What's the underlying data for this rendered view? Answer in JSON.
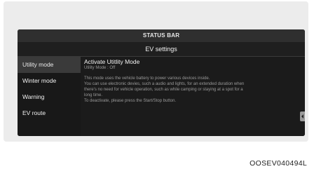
{
  "status_bar": {
    "label": "STATUS BAR"
  },
  "header": {
    "title": "EV settings"
  },
  "sidebar": {
    "items": [
      {
        "label": "Utility mode",
        "active": true
      },
      {
        "label": "Winter mode",
        "active": false
      },
      {
        "label": "Warning",
        "active": false
      },
      {
        "label": "EV route",
        "active": false
      }
    ]
  },
  "content": {
    "title": "Activate Utitlity Mode",
    "subtitle": "Utility Mode : Off",
    "body_lines": [
      "This mode uses the vehicle battery to power various devices inside.",
      "You can use electronic devies, such a audio and lights, for an extended duration when",
      "there's no need for vehicle operation, such as while camping or staying at a spot for a",
      "long time.",
      "To deactivate, please press the Start/Stop button."
    ]
  },
  "caption": "OOSEV040494L",
  "colors": {
    "screen_bg": "#141414",
    "status_bar_bg": "#2f2f2f",
    "active_item_bg": "#3a3a3a",
    "panel_bg": "#ececec"
  }
}
